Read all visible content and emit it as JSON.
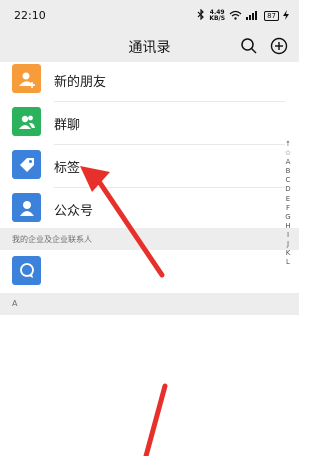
{
  "status_bar": {
    "time": "22:10",
    "speed_value": "4.49",
    "speed_unit": "KB/S",
    "battery": "87"
  },
  "header": {
    "title": "通讯录"
  },
  "contacts": [
    {
      "label": "新的朋友",
      "color": "#f79c3b"
    },
    {
      "label": "群聊",
      "color": "#2bb25c"
    },
    {
      "label": "标签",
      "color": "#3c82db"
    },
    {
      "label": "公众号",
      "color": "#3c82db"
    }
  ],
  "enterprise_section": {
    "title": "我的企业及企业联系人"
  },
  "section_a": {
    "title": "A"
  },
  "alpha_index": [
    "↑",
    "☆",
    "A",
    "B",
    "C",
    "D",
    "E",
    "F",
    "G",
    "H",
    "I",
    "J",
    "K",
    "L"
  ],
  "colors": {
    "accent_arrow": "#e8302a",
    "header_bg": "#ededed",
    "enterprise_icon": "#3c82db"
  }
}
